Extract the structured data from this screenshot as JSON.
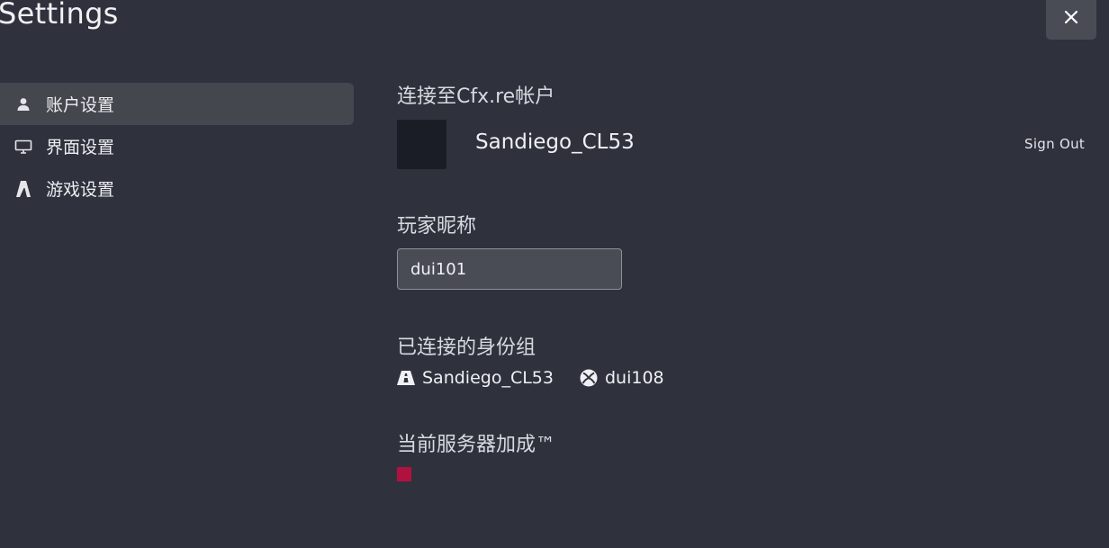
{
  "window": {
    "title": "Settings",
    "close_icon": "close-icon"
  },
  "sidebar": {
    "items": [
      {
        "label": "账户设置",
        "icon": "user-icon",
        "active": true
      },
      {
        "label": "界面设置",
        "icon": "monitor-icon",
        "active": false
      },
      {
        "label": "游戏设置",
        "icon": "game-logo-icon",
        "active": false
      }
    ]
  },
  "account": {
    "heading": "连接至Cfx.re帐户",
    "username": "Sandiego_CL53",
    "sign_out": "Sign Out"
  },
  "nickname": {
    "heading": "玩家昵称",
    "value": "dui101"
  },
  "identities": {
    "heading": "已连接的身份组",
    "items": [
      {
        "icon": "cfx-logo-icon",
        "name": "Sandiego_CL53"
      },
      {
        "icon": "xbox-icon",
        "name": "dui108"
      }
    ]
  },
  "boost": {
    "heading": "当前服务器加成™",
    "color": "#b0123f"
  },
  "colors": {
    "background": "#2f323d",
    "active_item": "#45474f",
    "input_bg": "#4a4c55",
    "accent": "#b0123f"
  }
}
